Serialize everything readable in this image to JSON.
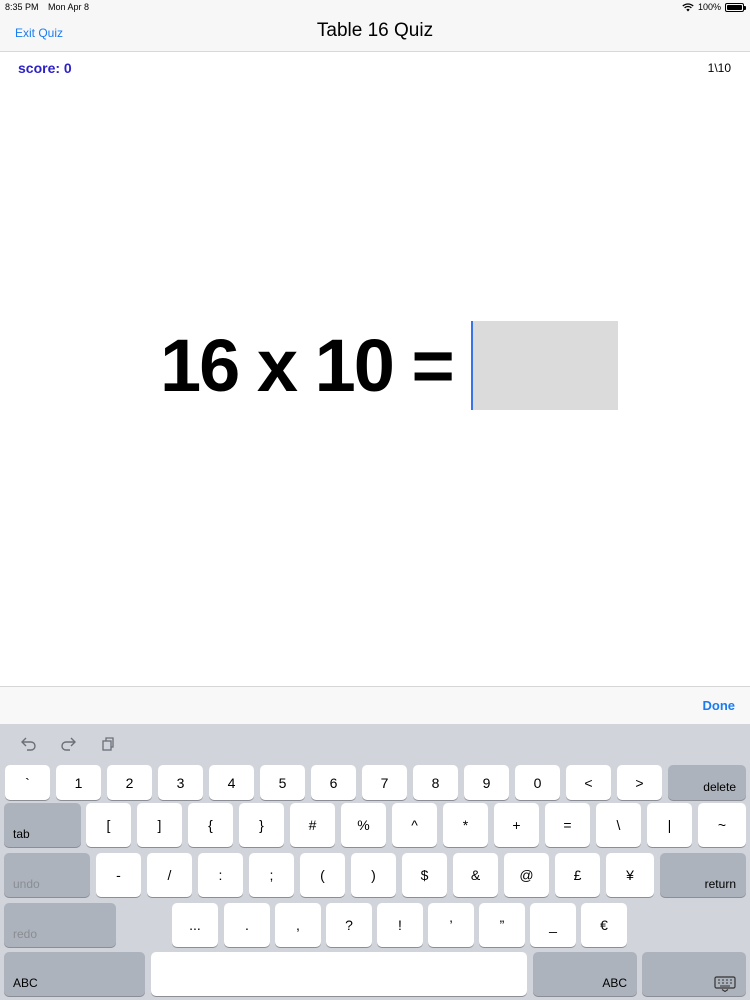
{
  "status": {
    "time": "8:35 PM",
    "date": "Mon Apr 8",
    "battery": "100%"
  },
  "nav": {
    "exit_label": "Exit Quiz",
    "title": "Table 16 Quiz"
  },
  "quiz": {
    "score_label": "score: 0",
    "progress": "1\\10",
    "question": "16 x 10 =",
    "answer_value": ""
  },
  "accessory": {
    "done_label": "Done"
  },
  "keyboard": {
    "row1": [
      "`",
      "1",
      "2",
      "3",
      "4",
      "5",
      "6",
      "7",
      "8",
      "9",
      "0",
      "<",
      ">"
    ],
    "delete_label": "delete",
    "tab_label": "tab",
    "row2": [
      "[",
      "]",
      "{",
      "}",
      "#",
      "%",
      "^",
      "*",
      "+",
      "=",
      "\\",
      "|",
      "~"
    ],
    "undo_label": "undo",
    "row3": [
      "-",
      "/",
      ":",
      ";",
      "(",
      ")",
      "$",
      "&",
      "@",
      "£",
      "¥"
    ],
    "return_label": "return",
    "redo_label": "redo",
    "row4": [
      "...",
      ".",
      ",",
      "?",
      "!",
      "’",
      "”",
      "_",
      "€"
    ],
    "abc_left_label": "ABC",
    "abc_right_label": "ABC",
    "shortcuts": [
      "undo-arrow",
      "redo-arrow",
      "paste-clipboard"
    ]
  }
}
